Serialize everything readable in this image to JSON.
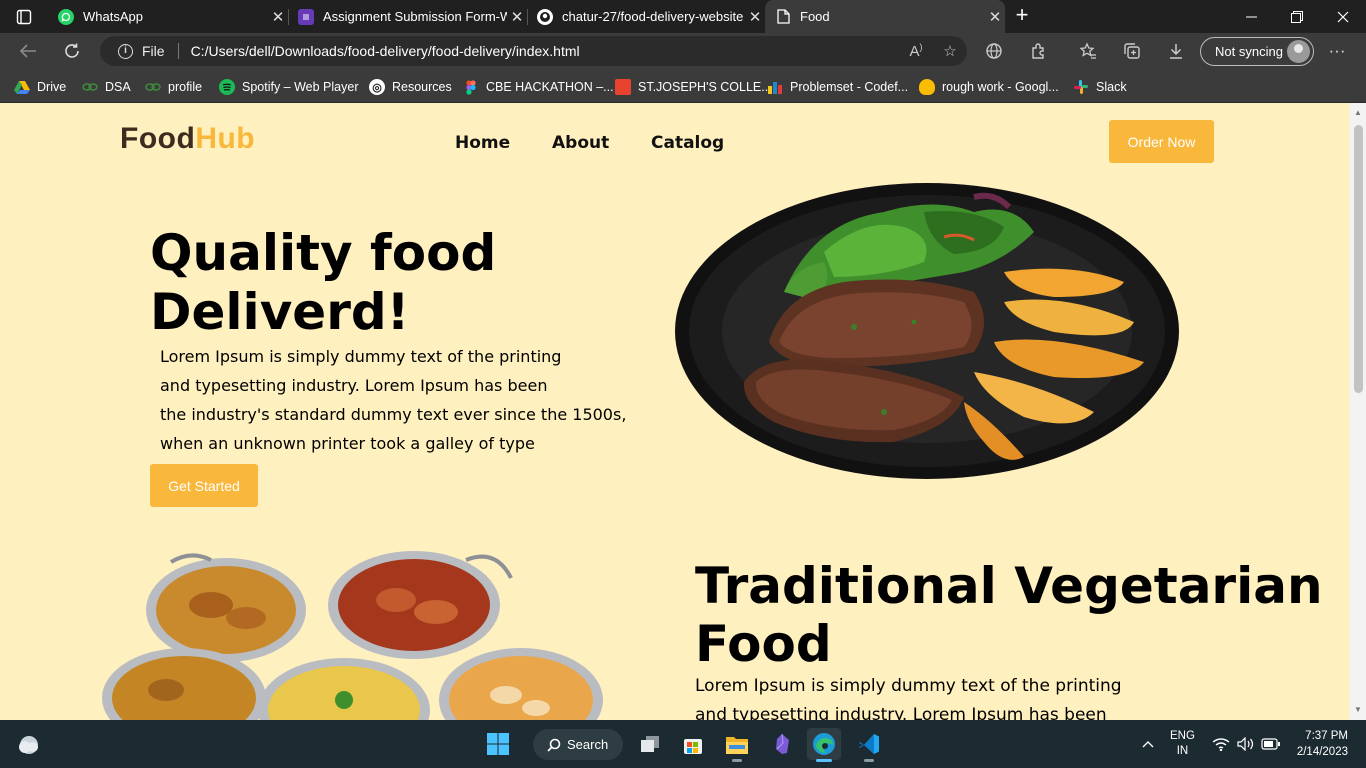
{
  "browser": {
    "tabs": [
      {
        "title": "WhatsApp",
        "active": false
      },
      {
        "title": "Assignment Submission Form-W",
        "active": false
      },
      {
        "title": "chatur-27/food-delivery-website",
        "active": false
      },
      {
        "title": "Food",
        "active": true
      }
    ],
    "address": {
      "file_label": "File",
      "url": "C:/Users/dell/Downloads/food-delivery/food-delivery/index.html"
    },
    "sync_label": "Not syncing",
    "bookmarks": [
      {
        "label": "Drive",
        "icon": "drive-icon",
        "color": "#34a853"
      },
      {
        "label": "DSA",
        "icon": "link-icon",
        "color": "#3d8b3d"
      },
      {
        "label": "profile",
        "icon": "link-icon",
        "color": "#3d8b3d"
      },
      {
        "label": "Spotify – Web Player",
        "icon": "spotify-icon",
        "color": "#1db954"
      },
      {
        "label": "Resources",
        "icon": "resources-icon",
        "color": "#ffffff"
      },
      {
        "label": "CBE HACKATHON –...",
        "icon": "figma-icon",
        "color": "#a259ff"
      },
      {
        "label": "ST.JOSEPH'S COLLE...",
        "icon": "college-icon",
        "color": "#e8432e"
      },
      {
        "label": "Problemset - Codef...",
        "icon": "codeforces-icon",
        "color": "#f5c518"
      },
      {
        "label": "rough work - Googl...",
        "icon": "keep-icon",
        "color": "#fbbc04"
      },
      {
        "label": "Slack",
        "icon": "slack-icon",
        "color": "#e01e5a"
      }
    ]
  },
  "page": {
    "logo": {
      "part1": "Food",
      "part2": "Hub"
    },
    "nav": [
      "Home",
      "About",
      "Catalog"
    ],
    "order_button": "Order Now",
    "hero": {
      "title_line1": "Quality food",
      "title_line2": "Deliverd!",
      "text_lines": [
        "Lorem Ipsum is simply dummy text of the printing",
        "and typesetting industry. Lorem Ipsum has been",
        "the industry's standard dummy text ever since the 1500s,",
        "when an unknown printer took a galley of type"
      ],
      "button": "Get Started"
    },
    "section2": {
      "title_line1": "Traditional Vegetarian",
      "title_line2": "Food",
      "text_lines": [
        "Lorem Ipsum is simply dummy text of the printing",
        "and typesetting industry. Lorem Ipsum has been"
      ]
    }
  },
  "taskbar": {
    "search_label": "Search",
    "lang_line1": "ENG",
    "lang_line2": "IN",
    "time": "7:37 PM",
    "date": "2/14/2023"
  },
  "colors": {
    "accent": "#f9b73b",
    "page_bg": "#fff0bf",
    "logo_dark": "#3d2b1f"
  }
}
